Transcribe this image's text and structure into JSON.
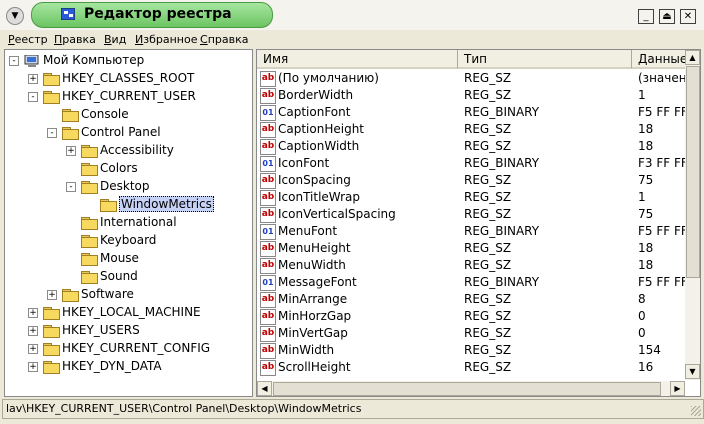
{
  "window": {
    "title": "Редактор реестра",
    "buttons": [
      "minimize-icon",
      "maximize-icon",
      "close-icon"
    ]
  },
  "menubar": {
    "items": [
      {
        "label": "Реестр",
        "u": "Р",
        "rest": "еестр"
      },
      {
        "label": "Правка",
        "u": "П",
        "rest": "равка"
      },
      {
        "label": "Вид",
        "u": "В",
        "rest": "ид"
      },
      {
        "label": "Избранное",
        "u": "И",
        "rest": "збранное"
      },
      {
        "label": "Справка",
        "u": "С",
        "rest": "правка"
      }
    ]
  },
  "tree": {
    "items": [
      {
        "label": "Мой Компьютер",
        "expander": "-",
        "icon": "computer-icon"
      },
      {
        "label": "HKEY_CLASSES_ROOT",
        "expander": "+",
        "icon": "folder-icon"
      },
      {
        "label": "HKEY_CURRENT_USER",
        "expander": "-",
        "icon": "folder-icon"
      },
      {
        "label": "Console",
        "expander": "",
        "icon": "folder-icon"
      },
      {
        "label": "Control Panel",
        "expander": "-",
        "icon": "folder-icon"
      },
      {
        "label": "Accessibility",
        "expander": "+",
        "icon": "folder-icon"
      },
      {
        "label": "Colors",
        "expander": "",
        "icon": "folder-icon"
      },
      {
        "label": "Desktop",
        "expander": "-",
        "icon": "folder-icon"
      },
      {
        "label": "WindowMetrics",
        "expander": "",
        "icon": "open-folder-icon",
        "selected": true
      },
      {
        "label": "International",
        "expander": "",
        "icon": "folder-icon"
      },
      {
        "label": "Keyboard",
        "expander": "",
        "icon": "folder-icon"
      },
      {
        "label": "Mouse",
        "expander": "",
        "icon": "folder-icon"
      },
      {
        "label": "Sound",
        "expander": "",
        "icon": "folder-icon"
      },
      {
        "label": "Software",
        "expander": "+",
        "icon": "folder-icon"
      },
      {
        "label": "HKEY_LOCAL_MACHINE",
        "expander": "+",
        "icon": "folder-icon"
      },
      {
        "label": "HKEY_USERS",
        "expander": "+",
        "icon": "folder-icon"
      },
      {
        "label": "HKEY_CURRENT_CONFIG",
        "expander": "+",
        "icon": "folder-icon"
      },
      {
        "label": "HKEY_DYN_DATA",
        "expander": "+",
        "icon": "folder-icon"
      }
    ]
  },
  "list": {
    "columns": [
      "Имя",
      "Тип",
      "Данные"
    ],
    "rows": [
      {
        "name": "(По умолчанию)",
        "type": "REG_SZ",
        "data": "(значение",
        "icon": "ab"
      },
      {
        "name": "BorderWidth",
        "type": "REG_SZ",
        "data": "1",
        "icon": "ab"
      },
      {
        "name": "CaptionFont",
        "type": "REG_BINARY",
        "data": "F5 FF FF",
        "icon": "bin"
      },
      {
        "name": "CaptionHeight",
        "type": "REG_SZ",
        "data": "18",
        "icon": "ab"
      },
      {
        "name": "CaptionWidth",
        "type": "REG_SZ",
        "data": "18",
        "icon": "ab"
      },
      {
        "name": "IconFont",
        "type": "REG_BINARY",
        "data": "F3 FF FF",
        "icon": "bin"
      },
      {
        "name": "IconSpacing",
        "type": "REG_SZ",
        "data": "75",
        "icon": "ab"
      },
      {
        "name": "IconTitleWrap",
        "type": "REG_SZ",
        "data": "1",
        "icon": "ab"
      },
      {
        "name": "IconVerticalSpacing",
        "type": "REG_SZ",
        "data": "75",
        "icon": "ab"
      },
      {
        "name": "MenuFont",
        "type": "REG_BINARY",
        "data": "F5 FF FF",
        "icon": "bin"
      },
      {
        "name": "MenuHeight",
        "type": "REG_SZ",
        "data": "18",
        "icon": "ab"
      },
      {
        "name": "MenuWidth",
        "type": "REG_SZ",
        "data": "18",
        "icon": "ab"
      },
      {
        "name": "MessageFont",
        "type": "REG_BINARY",
        "data": "F5 FF FF",
        "icon": "bin"
      },
      {
        "name": "MinArrange",
        "type": "REG_SZ",
        "data": "8",
        "icon": "ab"
      },
      {
        "name": "MinHorzGap",
        "type": "REG_SZ",
        "data": "0",
        "icon": "ab"
      },
      {
        "name": "MinVertGap",
        "type": "REG_SZ",
        "data": "0",
        "icon": "ab"
      },
      {
        "name": "MinWidth",
        "type": "REG_SZ",
        "data": "154",
        "icon": "ab"
      },
      {
        "name": "ScrollHeight",
        "type": "REG_SZ",
        "data": "16",
        "icon": "ab"
      }
    ]
  },
  "statusbar": {
    "path": "lav\\HKEY_CURRENT_USER\\Control Panel\\Desktop\\WindowMetrics"
  },
  "colors": {
    "title_pill": "#6cc462",
    "selection": "#c6d3f7"
  }
}
